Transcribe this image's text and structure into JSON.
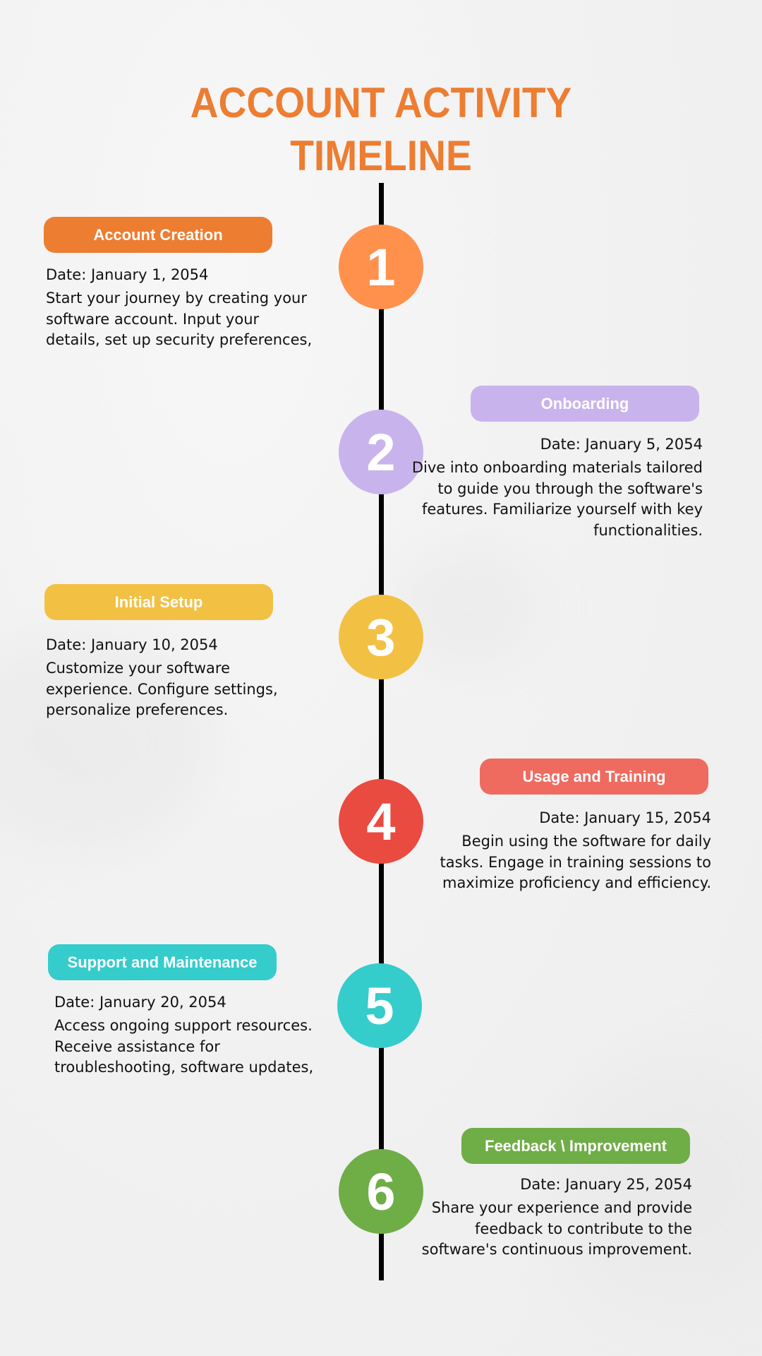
{
  "title": {
    "line1": "ACCOUNT ACTIVITY",
    "line2": "TIMELINE",
    "color": "#ED7D31"
  },
  "events": [
    {
      "number": "1",
      "label": "Account Creation",
      "date": "Date: January 1, 2054",
      "description": "Start your journey by creating your software account. Input your details, set up security preferences,",
      "pill_color": "#ED7D31",
      "circle_color": "#FF914D",
      "side": "left"
    },
    {
      "number": "2",
      "label": "Onboarding",
      "date": "Date: January 5, 2054",
      "description": "Dive into onboarding materials tailored to guide you through the software's features. Familiarize yourself with key functionalities.",
      "pill_color": "#C9B3EC",
      "circle_color": "#C9B3EC",
      "side": "right"
    },
    {
      "number": "3",
      "label": "Initial Setup",
      "date": "Date: January 10, 2054",
      "description": "Customize your software experience. Configure settings, personalize preferences.",
      "pill_color": "#F2C144",
      "circle_color": "#F2C144",
      "side": "left"
    },
    {
      "number": "4",
      "label": "Usage and Training",
      "date": "Date: January 15, 2054",
      "description": "Begin using the software for daily tasks. Engage in training sessions to maximize proficiency and efficiency.",
      "pill_color": "#EF6B60",
      "circle_color": "#E94B40",
      "side": "right"
    },
    {
      "number": "5",
      "label": "Support and Maintenance",
      "date": "Date: January 20, 2054",
      "description": "Access ongoing support resources. Receive assistance for troubleshooting, software updates,",
      "pill_color": "#35CCCC",
      "circle_color": "#35CCCC",
      "side": "left"
    },
    {
      "number": "6",
      "label": "Feedback \\ Improvement",
      "date": "Date: January 25, 2054",
      "description": "Share your experience and provide feedback to contribute to the software's continuous improvement.",
      "pill_color": "#6FAD47",
      "circle_color": "#6FAD47",
      "side": "right"
    }
  ]
}
